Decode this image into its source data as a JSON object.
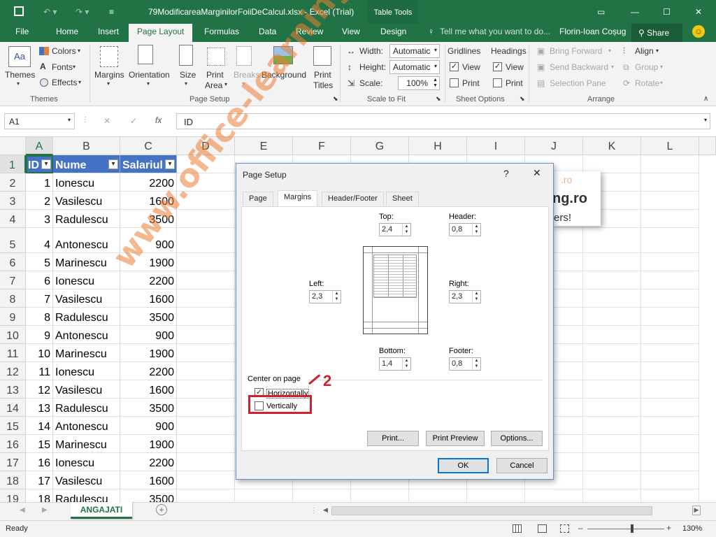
{
  "titlebar": {
    "filename": "79ModificareaMarginilorFoiiDeCalcul.xlsx - Excel (Trial)",
    "context": "Table Tools"
  },
  "tabs": [
    "File",
    "Home",
    "Insert",
    "Page Layout",
    "Formulas",
    "Data",
    "Review",
    "View",
    "Design"
  ],
  "tell_me": "Tell me what you want to do...",
  "user": "Florin-Ioan Coșug",
  "share": "Share",
  "ribbon": {
    "themes": {
      "themes": "Themes",
      "colors": "Colors",
      "fonts": "Fonts",
      "effects": "Effects",
      "group": "Themes"
    },
    "page_setup": {
      "margins": "Margins",
      "orientation": "Orientation",
      "size": "Size",
      "print_area_1": "Print",
      "print_area_2": "Area",
      "breaks": "Breaks",
      "background": "Background",
      "print_titles_1": "Print",
      "print_titles_2": "Titles",
      "group": "Page Setup"
    },
    "scale": {
      "width": "Width:",
      "height": "Height:",
      "scale": "Scale:",
      "width_val": "Automatic",
      "height_val": "Automatic",
      "scale_val": "100%",
      "group": "Scale to Fit"
    },
    "sheet_options": {
      "gridlines": "Gridlines",
      "headings": "Headings",
      "view": "View",
      "print": "Print",
      "group": "Sheet Options"
    },
    "arrange": {
      "bring_forward": "Bring Forward",
      "send_backward": "Send Backward",
      "selection_pane": "Selection Pane",
      "align": "Align",
      "group_btn": "Group",
      "rotate": "Rotate",
      "group": "Arrange"
    }
  },
  "formula_bar": {
    "name_box": "A1",
    "fx": "fx",
    "content": "ID"
  },
  "columns": [
    "A",
    "B",
    "C",
    "D",
    "E",
    "F",
    "G",
    "H",
    "I",
    "J",
    "K",
    "L"
  ],
  "table_headers": [
    "ID",
    "Nume",
    "Salariul"
  ],
  "rows": [
    {
      "r": "1"
    },
    {
      "r": "2",
      "id": "1",
      "name": "Ionescu",
      "sal": "2200"
    },
    {
      "r": "3",
      "id": "2",
      "name": "Vasilescu",
      "sal": "1600"
    },
    {
      "r": "4",
      "id": "3",
      "name": "Radulescu",
      "sal": "3500"
    },
    {
      "r": "5",
      "id": "4",
      "name": "Antonescu",
      "sal": "900"
    },
    {
      "r": "6",
      "id": "5",
      "name": "Marinescu",
      "sal": "1900"
    },
    {
      "r": "7",
      "id": "6",
      "name": "Ionescu",
      "sal": "2200"
    },
    {
      "r": "8",
      "id": "7",
      "name": "Vasilescu",
      "sal": "1600"
    },
    {
      "r": "9",
      "id": "8",
      "name": "Radulescu",
      "sal": "3500"
    },
    {
      "r": "10",
      "id": "9",
      "name": "Antonescu",
      "sal": "900"
    },
    {
      "r": "11",
      "id": "10",
      "name": "Marinescu",
      "sal": "1900"
    },
    {
      "r": "12",
      "id": "11",
      "name": "Ionescu",
      "sal": "2200"
    },
    {
      "r": "13",
      "id": "12",
      "name": "Vasilescu",
      "sal": "1600"
    },
    {
      "r": "14",
      "id": "13",
      "name": "Radulescu",
      "sal": "3500"
    },
    {
      "r": "15",
      "id": "14",
      "name": "Antonescu",
      "sal": "900"
    },
    {
      "r": "16",
      "id": "15",
      "name": "Marinescu",
      "sal": "1900"
    },
    {
      "r": "17",
      "id": "16",
      "name": "Ionescu",
      "sal": "2200"
    },
    {
      "r": "18",
      "id": "17",
      "name": "Vasilescu",
      "sal": "1600"
    },
    {
      "r": "19",
      "id": "18",
      "name": "Radulescu",
      "sal": "3500"
    }
  ],
  "logo_fragments": {
    "line1": ".ro",
    "line2": "ng.ro",
    "line3": "ers!"
  },
  "sheet_tab": "ANGAJATI",
  "status": {
    "ready": "Ready",
    "zoom": "130%"
  },
  "dialog": {
    "title": "Page Setup",
    "help": "?",
    "tabs": [
      "Page",
      "Margins",
      "Header/Footer",
      "Sheet"
    ],
    "top_label": "Top:",
    "top_val": "2,4",
    "header_label": "Header:",
    "header_val": "0,8",
    "left_label": "Left:",
    "left_val": "2,3",
    "right_label": "Right:",
    "right_val": "2,3",
    "bottom_label": "Bottom:",
    "bottom_val": "1,4",
    "footer_label": "Footer:",
    "footer_val": "0,8",
    "center_on_page": "Center on page",
    "horizontally": "Horizontally",
    "horizontally_checked": true,
    "vertically": "Vertically",
    "vertically_checked": false,
    "print": "Print...",
    "print_preview": "Print Preview",
    "options": "Options...",
    "ok": "OK",
    "cancel": "Cancel"
  },
  "annotation": "2",
  "watermark": "www.office-learning.ro",
  "colors": {
    "excel_green": "#217346",
    "annotation_red": "#d0202a",
    "table_header": "#4472c4",
    "watermark": "#ed7d31"
  }
}
